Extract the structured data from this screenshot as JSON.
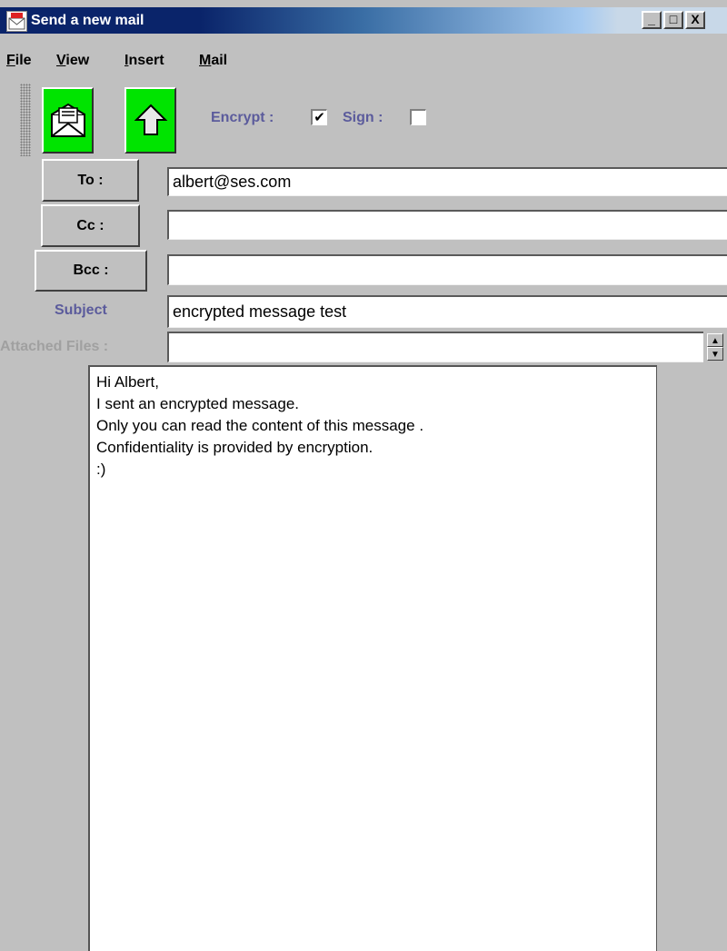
{
  "window": {
    "title": "Send a new mail",
    "controls": {
      "minimize": "_",
      "maximize": "□",
      "close": "X"
    }
  },
  "menu": {
    "items": [
      {
        "label": "File",
        "mnemonic": "F"
      },
      {
        "label": "View",
        "mnemonic": "V"
      },
      {
        "label": "Insert",
        "mnemonic": "I"
      },
      {
        "label": "Mail",
        "mnemonic": "M"
      }
    ]
  },
  "toolbar": {
    "send_icon": "envelope-icon",
    "upload_icon": "up-arrow-icon",
    "encrypt_label": "Encrypt :",
    "encrypt_checked": "✔",
    "sign_label": "Sign :",
    "sign_checked": ""
  },
  "form": {
    "to_label": "To :",
    "to_value": "albert@ses.com",
    "cc_label": "Cc :",
    "cc_value": "",
    "bcc_label": "Bcc :",
    "bcc_value": "",
    "subject_label": "Subject",
    "subject_value": "encrypted message test",
    "attached_label": "Attached Files :",
    "attached_value": ""
  },
  "body": {
    "lines": [
      "Hi Albert,",
      "I sent an encrypted message.",
      "Only you can read the content of this message .",
      "Confidentiality is provided by encryption.",
      ":)"
    ]
  },
  "colors": {
    "title_bar": "#0a246a",
    "toolbar_button": "#00e400",
    "label_accent": "#5b5b9c",
    "disabled_label": "#a0a0a0",
    "window_bg": "#c0c0c0"
  }
}
